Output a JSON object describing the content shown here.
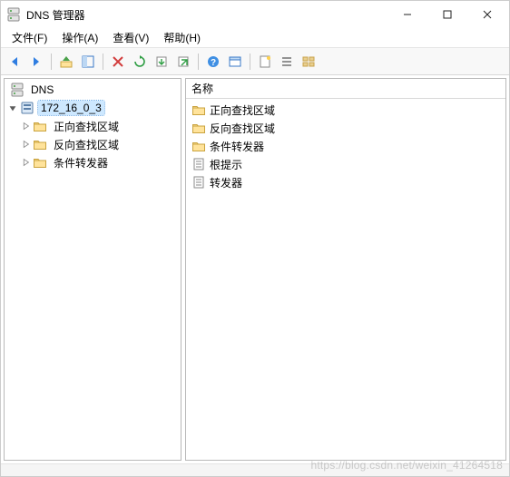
{
  "window": {
    "title": "DNS 管理器"
  },
  "menu": {
    "file": "文件(F)",
    "action": "操作(A)",
    "view": "查看(V)",
    "help": "帮助(H)"
  },
  "toolbar": {
    "back": "后退",
    "forward": "前进",
    "up": "上一级",
    "show_hide_tree": "显示/隐藏控制台树",
    "delete": "删除",
    "refresh": "刷新",
    "export": "导出列表",
    "launch": "启动",
    "help": "帮助",
    "properties": "属性",
    "new": "新建",
    "list1": "列表视图1",
    "list2": "列表视图2"
  },
  "tree": {
    "root": {
      "label": "DNS"
    },
    "server": {
      "label": "172_16_0_3"
    },
    "children": {
      "forward": "正向查找区域",
      "reverse": "反向查找区域",
      "conditional": "条件转发器"
    }
  },
  "list": {
    "header": "名称",
    "items": [
      {
        "icon": "folder",
        "label": "正向查找区域"
      },
      {
        "icon": "folder",
        "label": "反向查找区域"
      },
      {
        "icon": "folder",
        "label": "条件转发器"
      },
      {
        "icon": "doc",
        "label": "根提示"
      },
      {
        "icon": "doc",
        "label": "转发器"
      }
    ]
  },
  "watermark": "https://blog.csdn.net/weixin_41264518"
}
